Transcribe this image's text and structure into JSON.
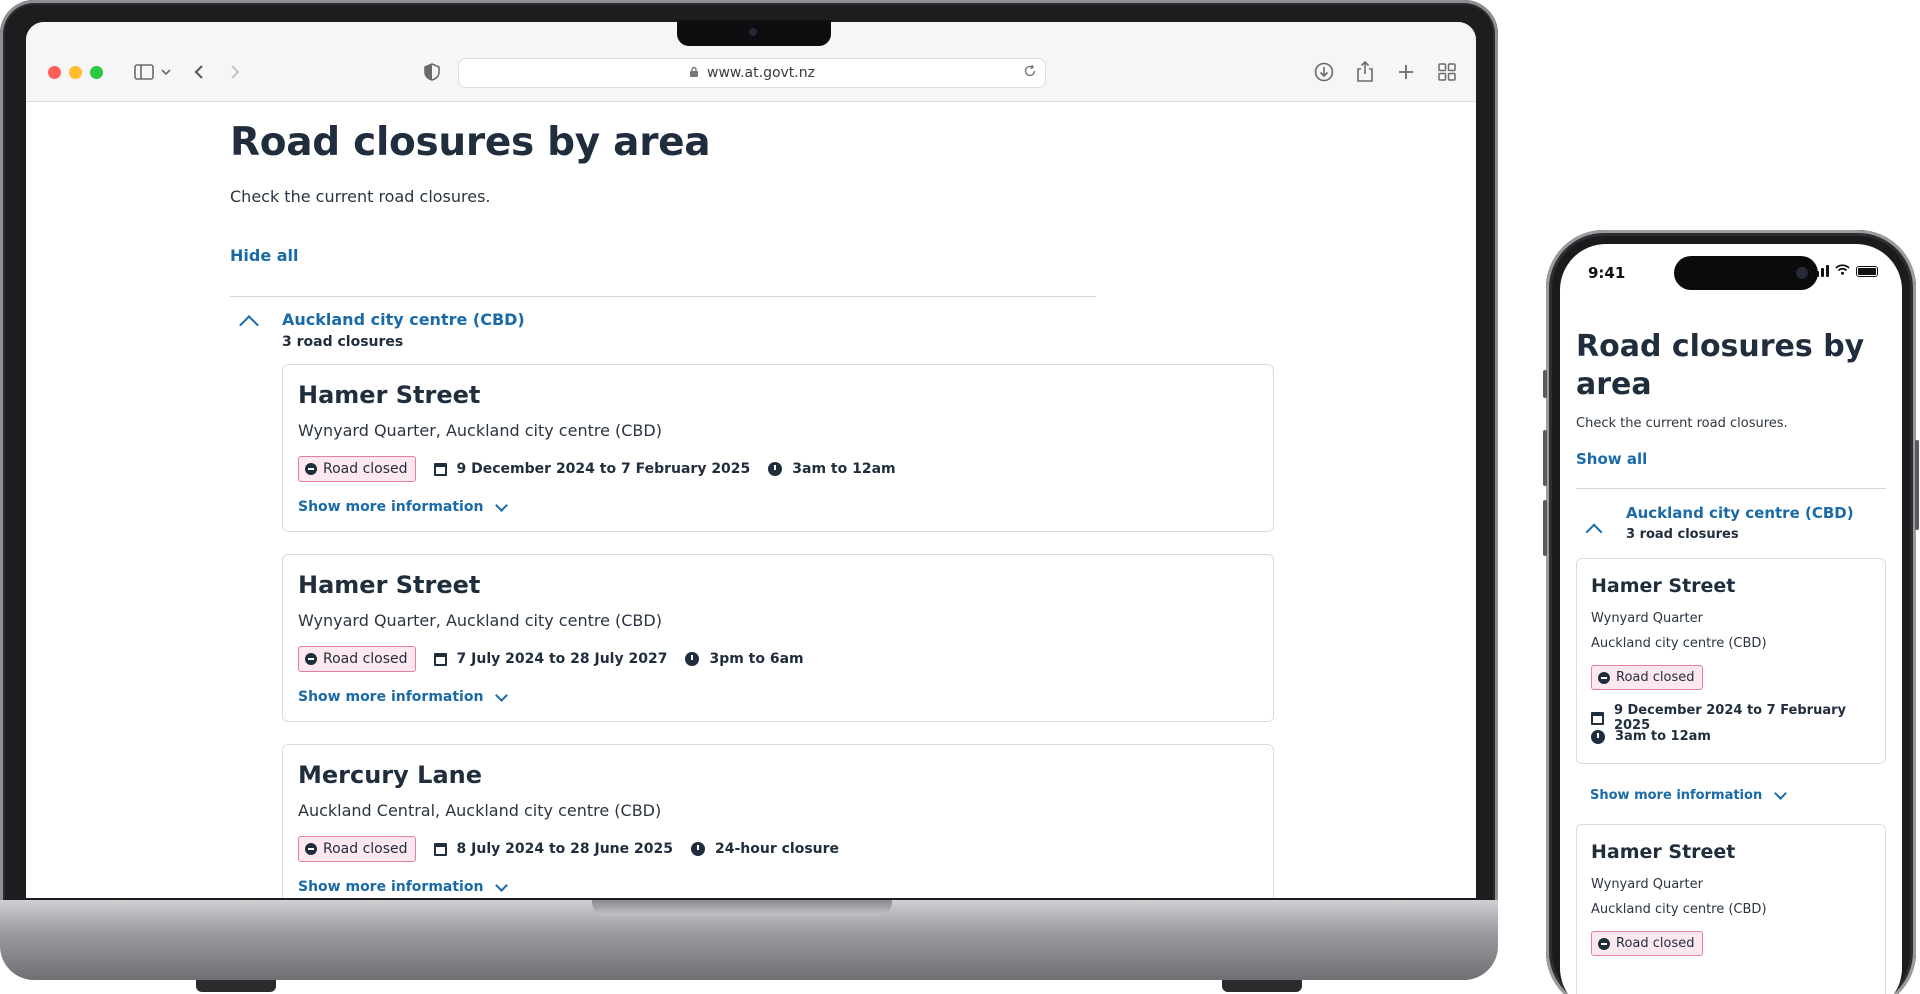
{
  "browser": {
    "url": "www.at.govt.nz"
  },
  "desktop": {
    "title": "Road closures by area",
    "subtitle": "Check the current road closures.",
    "toggle_label": "Hide all",
    "area": {
      "name": "Auckland city centre (CBD)",
      "count": "3 road closures"
    },
    "closures": [
      {
        "street": "Hamer Street",
        "location": "Wynyard Quarter, Auckland city centre (CBD)",
        "status": "Road closed",
        "dates": "9 December 2024 to 7 February 2025",
        "hours": "3am to 12am",
        "more": "Show more information"
      },
      {
        "street": "Hamer Street",
        "location": "Wynyard Quarter, Auckland city centre (CBD)",
        "status": "Road closed",
        "dates": "7 July 2024 to 28 July 2027",
        "hours": "3pm to 6am",
        "more": "Show more information"
      },
      {
        "street": "Mercury Lane",
        "location": "Auckland Central, Auckland city centre (CBD)",
        "status": "Road closed",
        "dates": "8 July 2024 to 28 June 2025",
        "hours": "24-hour closure",
        "more": "Show more information"
      }
    ]
  },
  "mobile": {
    "time": "9:41",
    "title": "Road closures by area",
    "subtitle": "Check the current road closures.",
    "toggle_label": "Show all",
    "area": {
      "name": "Auckland city centre (CBD)",
      "count": "3 road closures"
    },
    "closures": [
      {
        "street": "Hamer Street",
        "suburb": "Wynyard Quarter",
        "area": "Auckland city centre (CBD)",
        "status": "Road closed",
        "dates": "9 December 2024 to 7 February 2025",
        "hours": "3am to 12am",
        "more": "Show more information"
      },
      {
        "street": "Hamer Street",
        "suburb": "Wynyard Quarter",
        "area": "Auckland city centre (CBD)",
        "status": "Road closed"
      }
    ]
  },
  "colors": {
    "link": "#1a6aa8",
    "text": "#1f2d3d",
    "badge_bg": "#fde8ef",
    "badge_border": "#e27fa2"
  }
}
